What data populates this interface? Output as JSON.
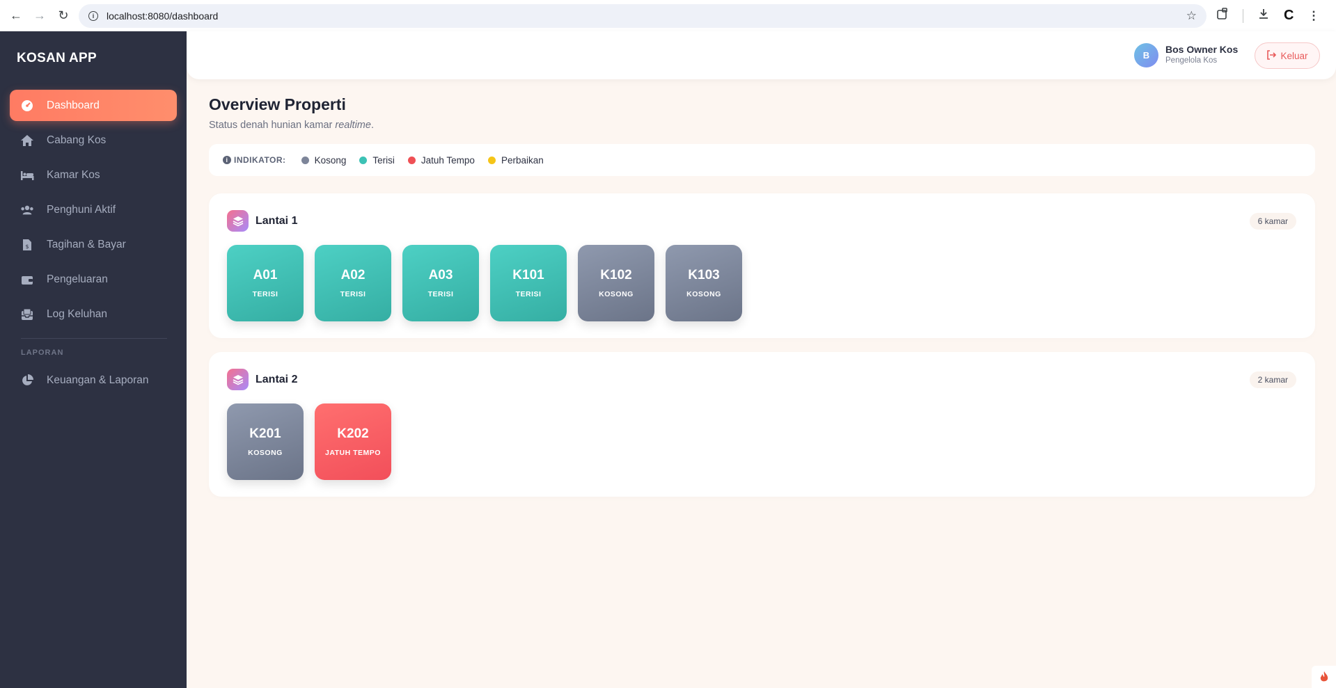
{
  "browser": {
    "url": "localhost:8080/dashboard"
  },
  "sidebar": {
    "brand": "KOSAN APP",
    "items": [
      {
        "label": "Dashboard",
        "icon": "dashboard-icon"
      },
      {
        "label": "Cabang Kos",
        "icon": "home-icon"
      },
      {
        "label": "Kamar Kos",
        "icon": "bed-icon"
      },
      {
        "label": "Penghuni Aktif",
        "icon": "users-icon"
      },
      {
        "label": "Tagihan & Bayar",
        "icon": "invoice-icon"
      },
      {
        "label": "Pengeluaran",
        "icon": "wallet-icon"
      },
      {
        "label": "Log Keluhan",
        "icon": "inbox-icon"
      }
    ],
    "section_label": "LAPORAN",
    "report_item": {
      "label": "Keuangan & Laporan",
      "icon": "pie-chart-icon"
    },
    "accent_color": "#ff7b63"
  },
  "header": {
    "avatar_initial": "B",
    "user_name": "Bos Owner Kos",
    "user_role": "Pengelola Kos",
    "logout_label": "Keluar"
  },
  "main": {
    "title": "Overview Properti",
    "subtitle": "Status denah hunian kamar",
    "subtitle_emphasis": "realtime",
    "legend": {
      "title": "INDIKATOR:",
      "items": [
        {
          "label": "Kosong",
          "color": "#7d8599"
        },
        {
          "label": "Terisi",
          "color": "#3cc2b5"
        },
        {
          "label": "Jatuh Tempo",
          "color": "#ef5055"
        },
        {
          "label": "Perbaikan",
          "color": "#f5c518"
        }
      ]
    },
    "floors": [
      {
        "title": "Lantai 1",
        "count": "6 kamar",
        "rooms": [
          {
            "code": "A01",
            "status": "TERISI"
          },
          {
            "code": "A02",
            "status": "TERISI"
          },
          {
            "code": "A03",
            "status": "TERISI"
          },
          {
            "code": "K101",
            "status": "TERISI"
          },
          {
            "code": "K102",
            "status": "KOSONG"
          },
          {
            "code": "K103",
            "status": "KOSONG"
          }
        ]
      },
      {
        "title": "Lantai 2",
        "count": "2 kamar",
        "rooms": [
          {
            "code": "K201",
            "status": "KOSONG"
          },
          {
            "code": "K202",
            "status": "JATUH TEMPO"
          }
        ]
      }
    ]
  }
}
